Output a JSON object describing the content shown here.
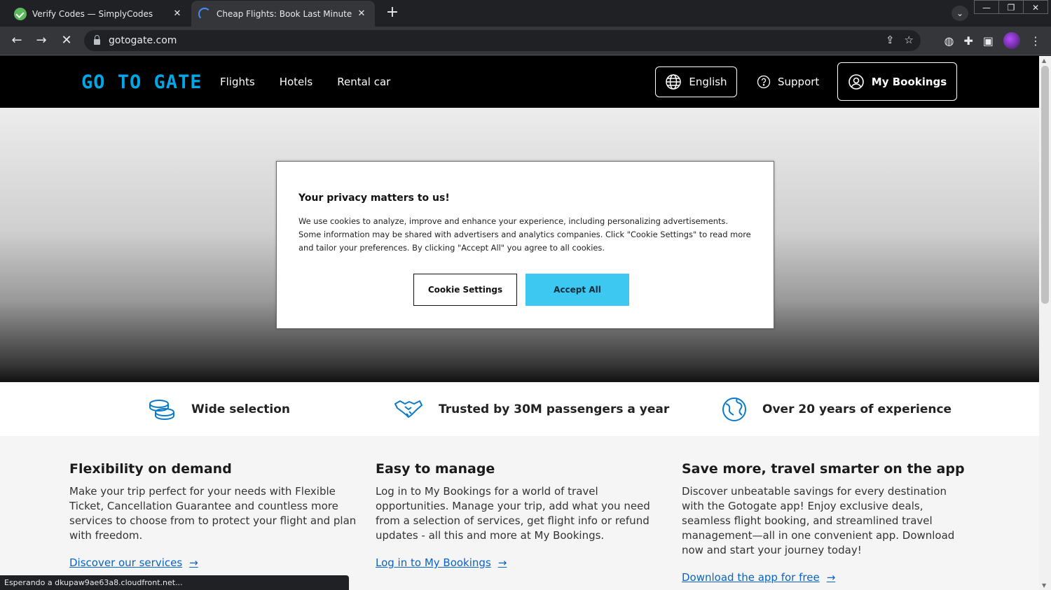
{
  "browser": {
    "tabs": [
      {
        "title": "Verify Codes — SimplyCodes",
        "active": false
      },
      {
        "title": "Cheap Flights: Book Last Minute Flights",
        "active": true
      }
    ],
    "url": "gotogate.com",
    "status_text": "Esperando a dkupaw9ae63a8.cloudfront.net..."
  },
  "header": {
    "logo": "GO TO GATE",
    "nav": [
      "Flights",
      "Hotels",
      "Rental car"
    ],
    "language": "English",
    "support": "Support",
    "my_bookings": "My Bookings"
  },
  "cookie": {
    "title": "Your privacy matters to us!",
    "body": "We use cookies to analyze, improve and enhance your experience, including personalizing advertisements. Some information may be shared with advertisers and analytics companies. Click \"Cookie Settings\" to read more and tailor your preferences. By clicking \"Accept All\" you agree to all cookies.",
    "settings_label": "Cookie Settings",
    "accept_label": "Accept All"
  },
  "features": [
    {
      "label": "Wide selection",
      "icon": "coins-icon"
    },
    {
      "label": "Trusted by 30M passengers a year",
      "icon": "handshake-icon"
    },
    {
      "label": "Over 20 years of experience",
      "icon": "globe-icon"
    }
  ],
  "cards": [
    {
      "title": "Flexibility on demand",
      "body": "Make your trip perfect for your needs with Flexible Ticket, Cancellation Guarantee and countless more services to choose from to protect your flight and plan with freedom.",
      "link": "Discover our services"
    },
    {
      "title": "Easy to manage",
      "body": "Log in to My Bookings for a world of travel opportunities. Manage your trip, add what you need from a selection of services, get flight info or refund updates - all this and more at My Bookings.",
      "link": "Log in to My Bookings"
    },
    {
      "title": "Save more, travel smarter on the app",
      "body": "Discover unbeatable savings for every destination with the Gotogate app! Enjoy exclusive deals, seamless flight booking, and streamlined travel management—all in one convenient app. Download now and start your journey today!",
      "link": "Download the app for free"
    }
  ],
  "colors": {
    "accent": "#00a6e5",
    "accept_button": "#3cc8f0",
    "link": "#0a63c4"
  }
}
